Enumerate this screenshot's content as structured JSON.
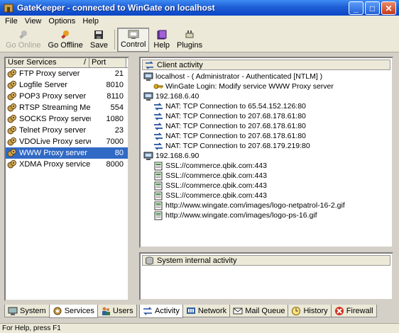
{
  "window": {
    "title": "GateKeeper - connected to WinGate on localhost"
  },
  "menu": [
    "File",
    "View",
    "Options",
    "Help"
  ],
  "toolbar": {
    "go_online": "Go Online",
    "go_offline": "Go Offline",
    "save": "Save",
    "control": "Control",
    "help": "Help",
    "plugins": "Plugins"
  },
  "services": {
    "col_name": "User Services",
    "col_sort": "/",
    "col_port": "Port",
    "items": [
      {
        "name": "FTP Proxy server",
        "port": "21"
      },
      {
        "name": "Logfile Server",
        "port": "8010"
      },
      {
        "name": "POP3 Proxy server",
        "port": "8110"
      },
      {
        "name": "RTSP Streaming Medi...",
        "port": "554"
      },
      {
        "name": "SOCKS Proxy server",
        "port": "1080"
      },
      {
        "name": "Telnet Proxy server",
        "port": "23"
      },
      {
        "name": "VDOLive Proxy server",
        "port": "7000"
      },
      {
        "name": "WWW Proxy server",
        "port": "80",
        "selected": true
      },
      {
        "name": "XDMA Proxy service",
        "port": "8000"
      }
    ]
  },
  "left_tabs": {
    "system": "System",
    "services": "Services",
    "users": "Users"
  },
  "client_activity": {
    "header": "Client activity",
    "nodes": [
      {
        "level": 0,
        "icon": "computer-icon",
        "text": "localhost - ( Administrator - Authenticated [NTLM] )"
      },
      {
        "level": 1,
        "icon": "key-icon",
        "text": "WinGate Login: Modify service WWW Proxy server"
      },
      {
        "level": 0,
        "icon": "computer-icon",
        "text": "192.168.6.40"
      },
      {
        "level": 1,
        "icon": "nat-icon",
        "text": "NAT: TCP Connection to 65.54.152.126:80"
      },
      {
        "level": 1,
        "icon": "nat-icon",
        "text": "NAT: TCP Connection to 207.68.178.61:80"
      },
      {
        "level": 1,
        "icon": "nat-icon",
        "text": "NAT: TCP Connection to 207.68.178.61:80"
      },
      {
        "level": 1,
        "icon": "nat-icon",
        "text": "NAT: TCP Connection to 207.68.178.61:80"
      },
      {
        "level": 1,
        "icon": "nat-icon",
        "text": "NAT: TCP Connection to 207.68.179.219:80"
      },
      {
        "level": 0,
        "icon": "computer-icon",
        "text": "192.168.6.90"
      },
      {
        "level": 1,
        "icon": "page-icon",
        "text": "SSL://commerce.qbik.com:443"
      },
      {
        "level": 1,
        "icon": "page-icon",
        "text": "SSL://commerce.qbik.com:443"
      },
      {
        "level": 1,
        "icon": "page-icon",
        "text": "SSL://commerce.qbik.com:443"
      },
      {
        "level": 1,
        "icon": "page-icon",
        "text": "SSL://commerce.qbik.com:443"
      },
      {
        "level": 1,
        "icon": "page-icon",
        "text": "http://www.wingate.com/images/logo-netpatrol-16-2.gif"
      },
      {
        "level": 1,
        "icon": "page-icon",
        "text": "http://www.wingate.com/images/logo-ps-16.gif"
      }
    ]
  },
  "system_activity": {
    "header": "System internal activity"
  },
  "right_tabs": {
    "activity": "Activity",
    "network": "Network",
    "mail_queue": "Mail Queue",
    "history": "History",
    "firewall": "Firewall"
  },
  "status": {
    "text": "For Help, press F1"
  }
}
